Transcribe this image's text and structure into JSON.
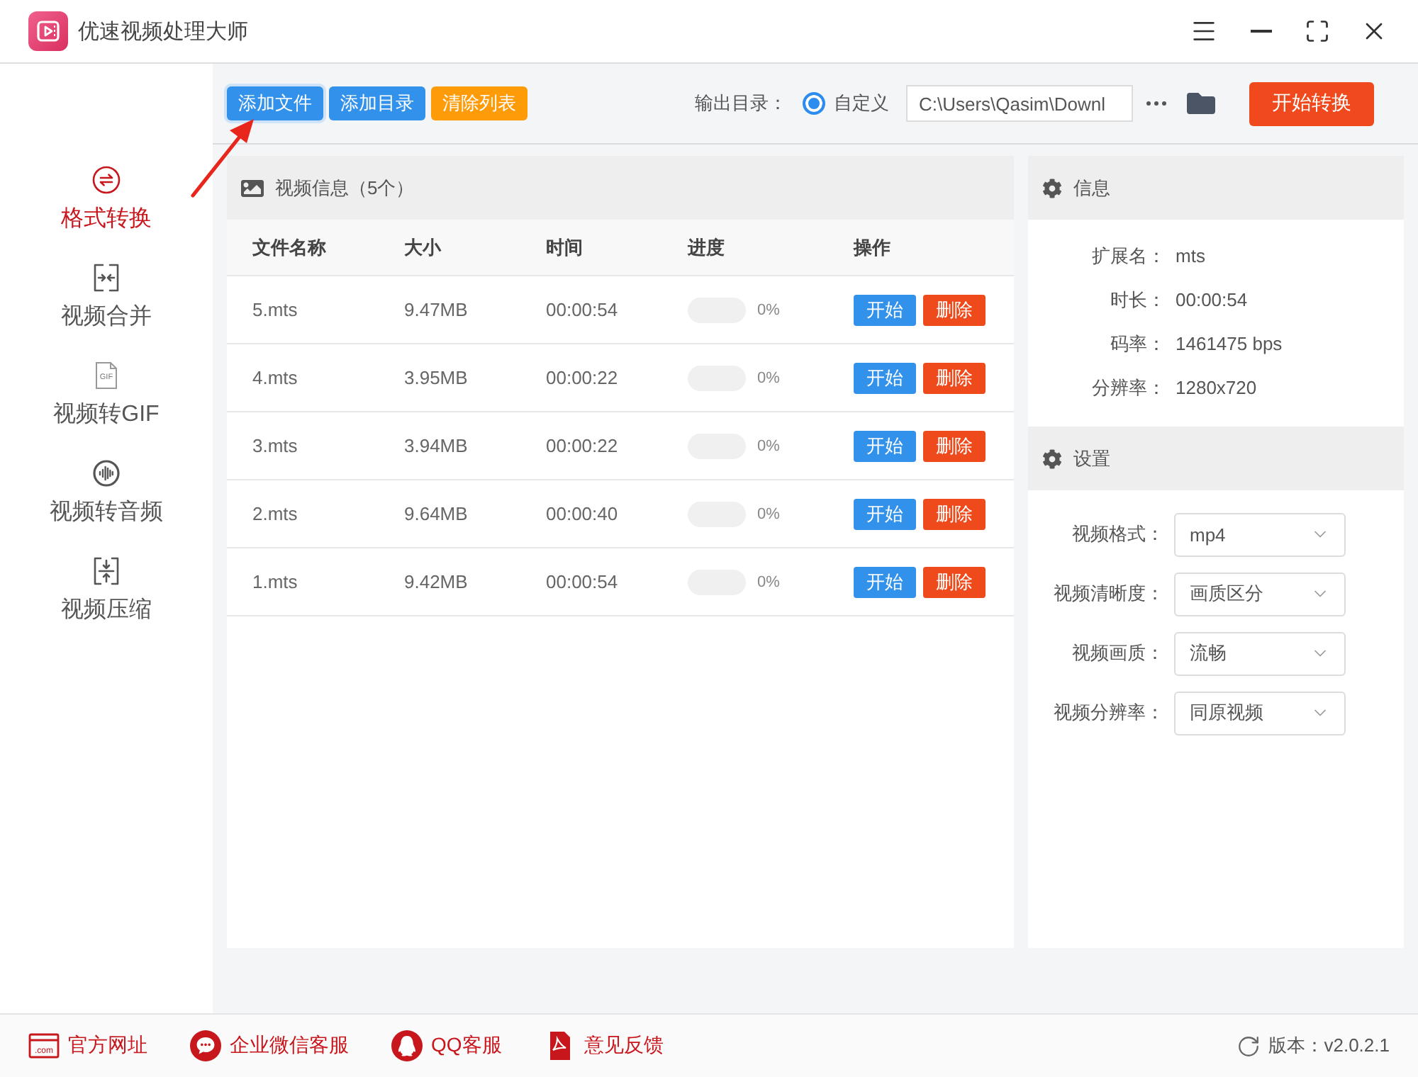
{
  "window": {
    "title": "优速视频处理大师"
  },
  "toolbar": {
    "buttons": [
      {
        "label": "添加文件",
        "kind": "primary",
        "focused": true
      },
      {
        "label": "添加目录",
        "kind": "primary",
        "focused": false
      },
      {
        "label": "清除列表",
        "kind": "warning",
        "focused": false
      }
    ],
    "output": {
      "label": "输出目录：",
      "options": [
        {
          "label": "自定义",
          "selected": true
        }
      ],
      "path": "C:\\Users\\Qasim\\Downl"
    },
    "start_button": "开始转换"
  },
  "sidebar": {
    "items": [
      {
        "label": "格式转换",
        "selected": true
      },
      {
        "label": "视频合并",
        "selected": false
      },
      {
        "label": "视频转GIF",
        "selected": false,
        "icon_text": "GIF"
      },
      {
        "label": "视频转音频",
        "selected": false
      },
      {
        "label": "视频压缩",
        "selected": false
      }
    ]
  },
  "file_list": {
    "title": "视频信息（5个）",
    "columns": [
      "文件名称",
      "大小",
      "时间",
      "进度",
      "操作"
    ],
    "rows": [
      {
        "name": "5.mts",
        "size": "9.47MB",
        "time": "00:00:54",
        "level": 0,
        "progress": "0%",
        "actions": [
          {
            "label": "开始",
            "kind": "start"
          },
          {
            "label": "删除",
            "kind": "delete"
          }
        ]
      },
      {
        "name": "4.mts",
        "size": "3.95MB",
        "time": "00:00:22",
        "level": 0,
        "progress": "0%",
        "actions": [
          {
            "label": "开始",
            "kind": "start"
          },
          {
            "label": "删除",
            "kind": "delete"
          }
        ]
      },
      {
        "name": "3.mts",
        "size": "3.94MB",
        "time": "00:00:22",
        "level": 0,
        "progress": "0%",
        "actions": [
          {
            "label": "开始",
            "kind": "start"
          },
          {
            "label": "删除",
            "kind": "delete"
          }
        ]
      },
      {
        "name": "2.mts",
        "size": "9.64MB",
        "time": "00:00:40",
        "level": 0,
        "progress": "0%",
        "actions": [
          {
            "label": "开始",
            "kind": "start"
          },
          {
            "label": "删除",
            "kind": "delete"
          }
        ]
      },
      {
        "name": "1.mts",
        "size": "9.42MB",
        "time": "00:00:54",
        "level": 0,
        "progress": "0%",
        "actions": [
          {
            "label": "开始",
            "kind": "start"
          },
          {
            "label": "删除",
            "kind": "delete"
          }
        ]
      }
    ]
  },
  "info_panel": {
    "title": "信息",
    "fields": [
      {
        "label": "扩展名：",
        "value": "mts"
      },
      {
        "label": "时长：",
        "value": "00:00:54"
      },
      {
        "label": "码率：",
        "value": "1461475 bps"
      },
      {
        "label": "分辨率：",
        "value": "1280x720"
      }
    ]
  },
  "settings_panel": {
    "title": "设置",
    "fields": [
      {
        "label": "视频格式：",
        "value": "mp4"
      },
      {
        "label": "视频清晰度：",
        "value": "画质区分"
      },
      {
        "label": "视频画质：",
        "value": "流畅"
      },
      {
        "label": "视频分辨率：",
        "value": "同原视频"
      }
    ]
  },
  "footer": {
    "links": [
      {
        "label": "官方网址",
        "icon_text": ".com"
      },
      {
        "label": "企业微信客服"
      },
      {
        "label": "QQ客服"
      },
      {
        "label": "意见反馈"
      }
    ],
    "version": "版本：v2.0.2.1"
  }
}
